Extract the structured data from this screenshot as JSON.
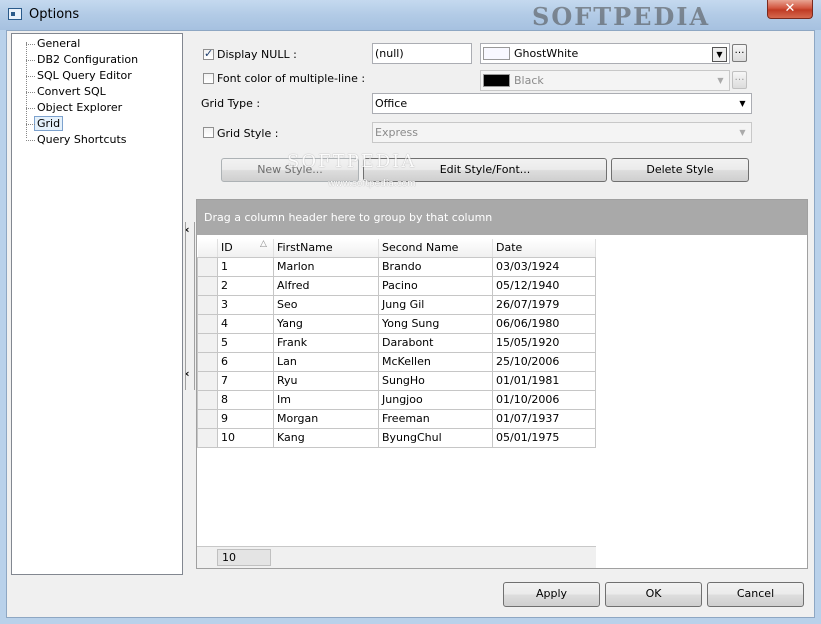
{
  "window": {
    "title": "Options",
    "close_glyph": "✕",
    "watermark": "SOFTPEDIA"
  },
  "tree": {
    "items": [
      {
        "label": "General",
        "selected": false
      },
      {
        "label": "DB2 Configuration",
        "selected": false
      },
      {
        "label": "SQL Query Editor",
        "selected": false
      },
      {
        "label": "Convert SQL",
        "selected": false
      },
      {
        "label": "Object Explorer",
        "selected": false
      },
      {
        "label": "Grid",
        "selected": true
      },
      {
        "label": "Query Shortcuts",
        "selected": false
      }
    ]
  },
  "settings": {
    "display_null": {
      "label": "Display NULL :",
      "checked": true,
      "value": "(null)"
    },
    "display_null_color": {
      "label": "GhostWhite",
      "swatch": "#f8f8ff",
      "dots": "…"
    },
    "font_color": {
      "label": "Font color of multiple-line :",
      "checked": false
    },
    "font_color_value": {
      "label": "Black",
      "swatch": "#000000",
      "dots": "…"
    },
    "grid_type": {
      "label": "Grid Type :",
      "value": "Office"
    },
    "grid_style": {
      "label": "Grid Style :",
      "checked": false,
      "value": "Express"
    }
  },
  "style_buttons": {
    "new": "New Style...",
    "edit": "Edit Style/Font...",
    "delete": "Delete Style"
  },
  "watermark_mid": {
    "big": "SOFTPEDIA",
    "small": "www.softpedia.com"
  },
  "grid": {
    "group_panel_text": "Drag a column header here to group by that column",
    "columns": [
      "ID",
      "FirstName",
      "Second Name",
      "Date"
    ],
    "sort_glyph": "△",
    "rows": [
      [
        "1",
        "Marlon",
        "Brando",
        "03/03/1924"
      ],
      [
        "2",
        "Alfred",
        "Pacino",
        "05/12/1940"
      ],
      [
        "3",
        "Seo",
        "Jung Gil",
        "26/07/1979"
      ],
      [
        "4",
        "Yang",
        "Yong Sung",
        "06/06/1980"
      ],
      [
        "5",
        "Frank",
        "Darabont",
        "15/05/1920"
      ],
      [
        "6",
        "Lan",
        "McKellen",
        "25/10/2006"
      ],
      [
        "7",
        "Ryu",
        "SungHo",
        "01/01/1981"
      ],
      [
        "8",
        "Im",
        "Jungjoo",
        "01/10/2006"
      ],
      [
        "9",
        "Morgan",
        "Freeman",
        "01/07/1937"
      ],
      [
        "10",
        "Kang",
        "ByungChul",
        "05/01/1975"
      ]
    ],
    "footer_count": "10",
    "splitter_glyph": "‹"
  },
  "dialog_buttons": {
    "apply": "Apply",
    "ok": "OK",
    "cancel": "Cancel"
  }
}
